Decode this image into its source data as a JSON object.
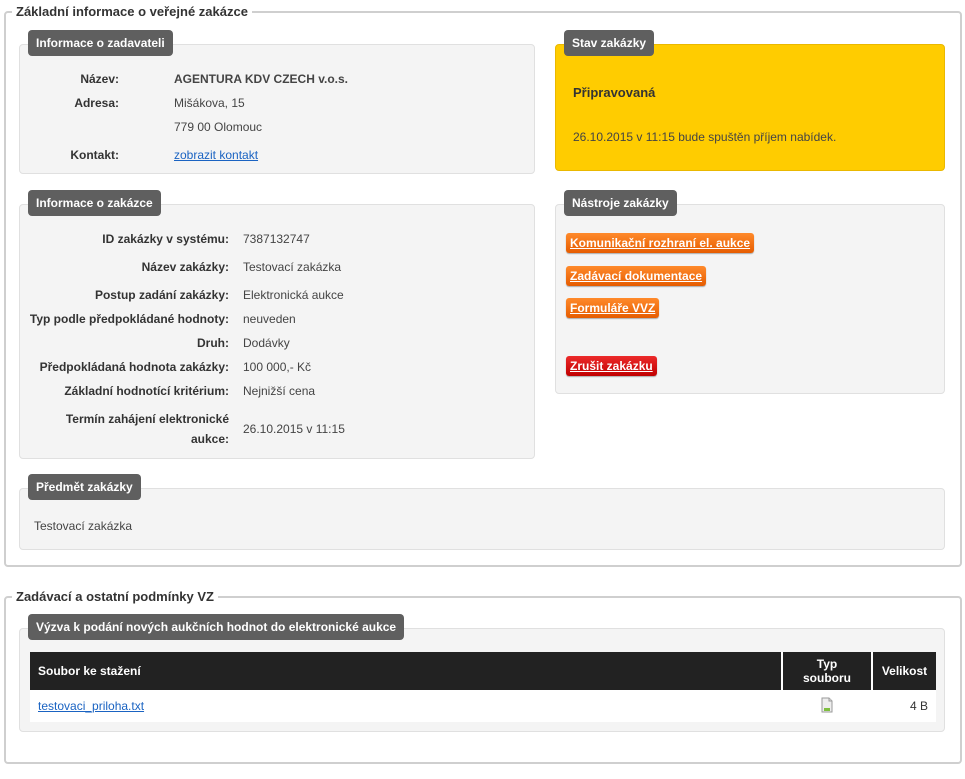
{
  "section1": {
    "legend": "Základní informace o veřejné zakázce",
    "zadavatel": {
      "title": "Informace o zadavateli",
      "nazev_label": "Název:",
      "nazev": "AGENTURA KDV CZECH v.o.s.",
      "adresa_label": "Adresa:",
      "adresa1": "Mišákova, 15",
      "adresa2": "779 00 Olomouc",
      "kontakt_label": "Kontakt:",
      "kontakt_link": "zobrazit kontakt"
    },
    "stav": {
      "title": "Stav zakázky",
      "status": "Připravovaná",
      "note": "26.10.2015 v 11:15 bude spuštěn příjem nabídek.",
      "color": "#ffcc00"
    },
    "zakazka": {
      "title": "Informace o zakázce",
      "rows": [
        {
          "label": "ID zakázky v systému:",
          "value": "7387132747"
        },
        {
          "label": "Název zakázky:",
          "value": "Testovací zakázka"
        },
        {
          "label": "Postup zadání zakázky:",
          "value": "Elektronická aukce"
        },
        {
          "label": "Typ podle předpokládané hodnoty:",
          "value": "neuveden"
        },
        {
          "label": "Druh:",
          "value": "Dodávky"
        },
        {
          "label": "Předpokládaná hodnota zakázky:",
          "value": "100 000,- Kč"
        },
        {
          "label": "Základní hodnotící kritérium:",
          "value": "Nejnižší cena"
        }
      ],
      "termin_label1": "Termín zahájení elektronické",
      "termin_label2": "aukce:",
      "termin_value": "26.10.2015 v 11:15"
    },
    "nastroje": {
      "title": "Nástroje zakázky",
      "btn_komunikacni": "Komunikační rozhraní el. aukce",
      "btn_dokumentace": "Zadávací dokumentace",
      "btn_formulare": "Formuláře VVZ",
      "btn_zrusit": "Zrušit zakázku"
    },
    "predmet": {
      "title": "Předmět zakázky",
      "text": "Testovací zakázka"
    }
  },
  "section2": {
    "legend": "Zadávací a ostatní podmínky VZ",
    "vyzva_title": "Výzva k podání nových aukčních hodnot do elektronické aukce",
    "table": {
      "col_soubor": "Soubor ke stažení",
      "col_typ1": "Typ",
      "col_typ2": "souboru",
      "col_velikost": "Velikost",
      "rows": [
        {
          "file": "testovaci_priloha.txt",
          "type_icon": "text-file-icon",
          "size": "4 B"
        }
      ]
    }
  }
}
